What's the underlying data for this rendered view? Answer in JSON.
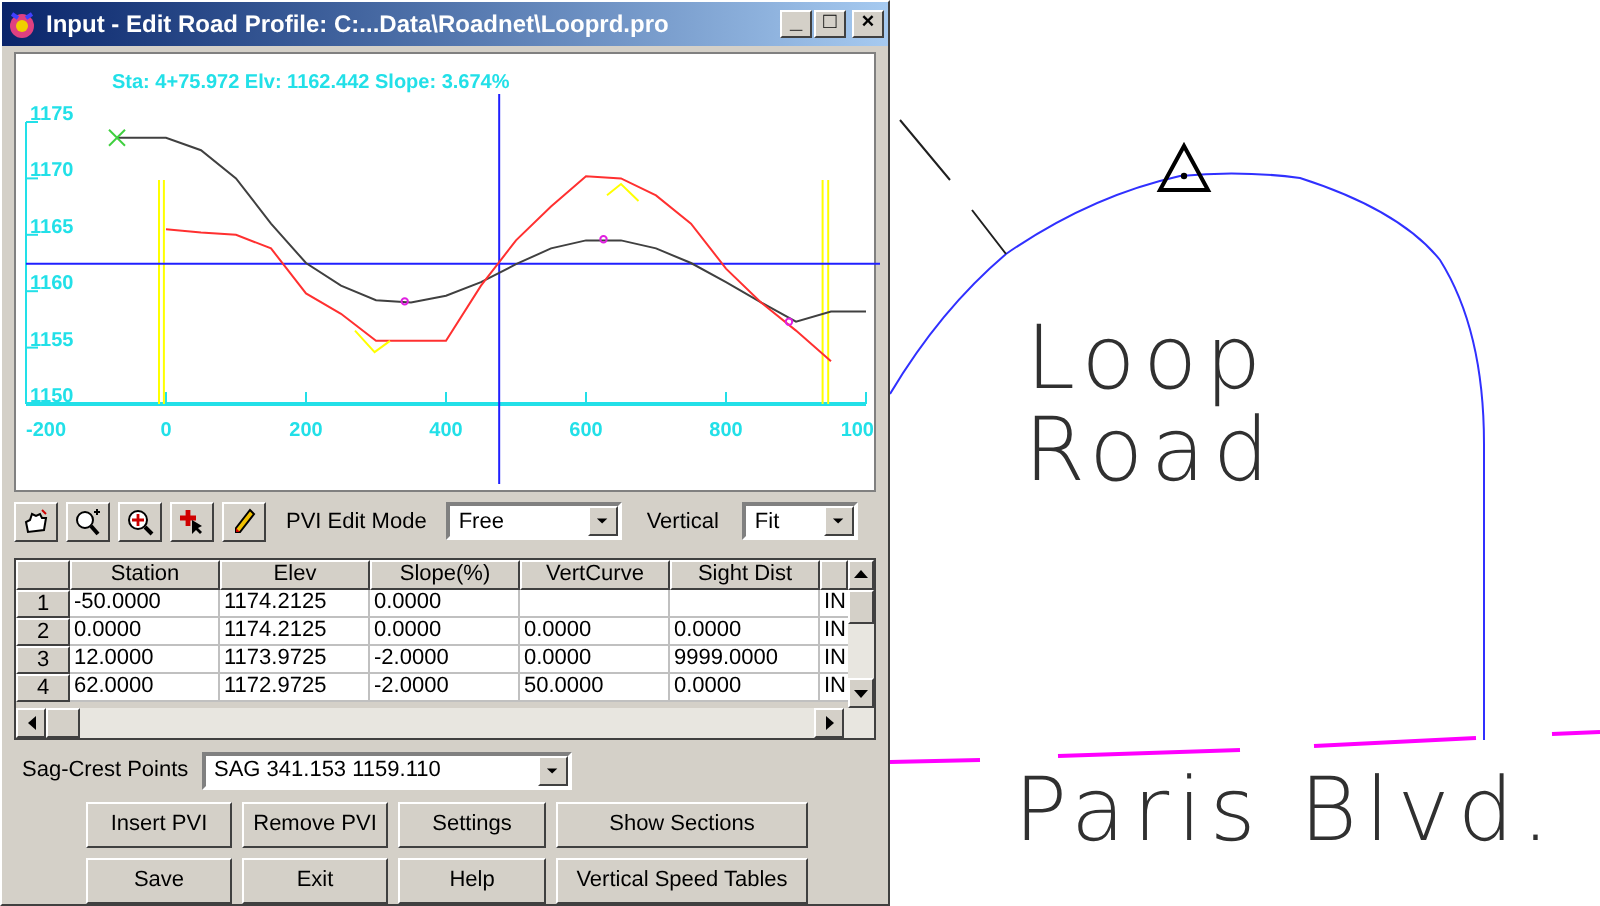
{
  "window": {
    "title": "Input - Edit Road Profile: C:...Data\\Roadnet\\Looprd.pro",
    "controls": [
      "_",
      "□",
      "×"
    ]
  },
  "profile": {
    "readout": "Sta: 4+75.972 Elv: 1162.442 Slope: 3.674%",
    "edge_tick_label": "100",
    "chart_data": {
      "type": "line",
      "x": [
        -70,
        0,
        50,
        100,
        150,
        200,
        250,
        300,
        350,
        400,
        450,
        500,
        550,
        600,
        650,
        700,
        750,
        800,
        850,
        900,
        950,
        1000
      ],
      "xlim": [
        -200,
        1000
      ],
      "ylim": [
        1150,
        1175
      ],
      "ref_lines": [
        {
          "axis": "x",
          "value": -10,
          "color": "#ffff00"
        },
        {
          "axis": "x",
          "value": -3,
          "color": "#ffff00"
        },
        {
          "axis": "x",
          "value": 938,
          "color": "#ffff00"
        },
        {
          "axis": "x",
          "value": 946,
          "color": "#ffff00"
        },
        {
          "axis": "y",
          "value": 1162.442,
          "color": "#2020ff"
        },
        {
          "axis": "x",
          "value": 475.972,
          "color": "#2020ff"
        }
      ],
      "xticks": [
        -200,
        0,
        200,
        400,
        600,
        800
      ],
      "yticks": [
        1150,
        1155,
        1160,
        1165,
        1170,
        1175
      ],
      "series": [
        {
          "color": "#404040",
          "values": [
            1173.6,
            1173.6,
            1172.5,
            1170,
            1166,
            1162.5,
            1160.5,
            1159.2,
            1159,
            1159.6,
            1160.8,
            1162.4,
            1163.8,
            1164.5,
            1164.5,
            1163.8,
            1162.5,
            1160.8,
            1159,
            1157.3,
            1158.2,
            1158.2
          ]
        },
        {
          "color": "#ff3030",
          "values": [
            null,
            1165.5,
            1165.2,
            1165,
            1163.8,
            1159.8,
            1158,
            1155.6,
            1155.6,
            1155.6,
            1160.5,
            1164.5,
            1167.5,
            1170.2,
            1170,
            1168.5,
            1166,
            1162,
            1159,
            1156.5,
            1153.8,
            null
          ]
        }
      ]
    }
  },
  "toolbar": {
    "tools": [
      {
        "kind": "pan"
      },
      {
        "kind": "zoom"
      },
      {
        "kind": "zoom-window"
      },
      {
        "kind": "pick"
      },
      {
        "kind": "pencil"
      }
    ],
    "edit_mode": {
      "label": "PVI Edit Mode",
      "value": "Free"
    },
    "vertical": {
      "label": "Vertical",
      "value": "Fit"
    }
  },
  "table": {
    "columns": [
      "Station",
      "Elev",
      "Slope(%)",
      "VertCurve",
      "Sight Dist"
    ],
    "rows": [
      {
        "index": "1",
        "station": "-50.0000",
        "elev": "1174.2125",
        "slope": "0.0000",
        "column_6": "IN"
      },
      {
        "index": "2",
        "station": "0.0000",
        "elev": "1174.2125",
        "slope": "0.0000",
        "vert_curve": "0.0000",
        "sight_dist": "0.0000",
        "column_6": "IN"
      },
      {
        "index": "3",
        "station": "12.0000",
        "elev": "1173.9725",
        "slope": "-2.0000",
        "vert_curve": "0.0000",
        "sight_dist": "9999.0000",
        "column_6": "IN"
      },
      {
        "index": "4",
        "station": "62.0000",
        "elev": "1172.9725",
        "slope": "-2.0000",
        "vert_curve": "50.0000",
        "sight_dist": "0.0000",
        "column_6": "IN"
      }
    ]
  },
  "sag_crest": {
    "label": "Sag-Crest Points",
    "value": "SAG 341.153 1159.110"
  },
  "buttons": [
    [
      "Insert PVI",
      "Remove PVI",
      "Settings",
      "Show Sections"
    ],
    [
      "Save",
      "Exit",
      "Help",
      "Vertical Speed Tables"
    ]
  ],
  "map": {
    "labels": [
      {
        "text": "Loop"
      },
      {
        "text": "Road"
      },
      {
        "text": "Paris Blvd."
      }
    ]
  }
}
